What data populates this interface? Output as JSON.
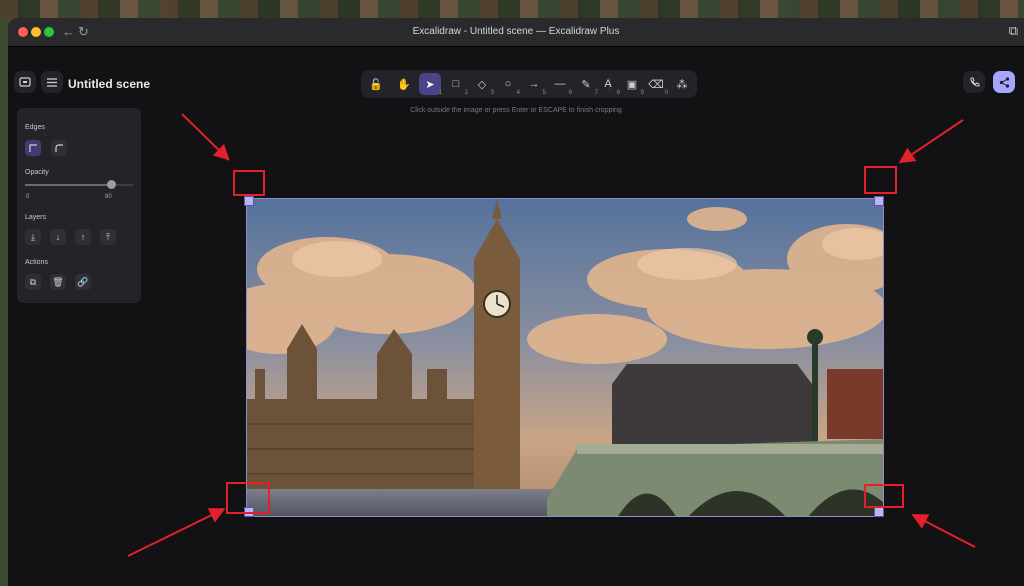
{
  "window": {
    "title": "Excalidraw - Untitled scene — Excalidraw Plus",
    "back_icon": "arrow-left-icon",
    "reload_icon": "reload-icon",
    "extension_icon": "puzzle-icon"
  },
  "header": {
    "scene_title": "Untitled scene",
    "library_icon": "library-icon",
    "menu_icon": "hamburger-icon",
    "call_icon": "phone-icon",
    "share_icon": "share-icon"
  },
  "toolbar": {
    "tools": [
      {
        "name": "lock",
        "glyph": "🔓",
        "key": ""
      },
      {
        "name": "hand",
        "glyph": "✋",
        "key": ""
      },
      {
        "name": "selection",
        "glyph": "➤",
        "key": "1"
      },
      {
        "name": "rectangle",
        "glyph": "□",
        "key": "2"
      },
      {
        "name": "diamond",
        "glyph": "◇",
        "key": "3"
      },
      {
        "name": "ellipse",
        "glyph": "○",
        "key": "4"
      },
      {
        "name": "arrow",
        "glyph": "→",
        "key": "5"
      },
      {
        "name": "line",
        "glyph": "—",
        "key": "6"
      },
      {
        "name": "draw",
        "glyph": "✎",
        "key": "7"
      },
      {
        "name": "text",
        "glyph": "A",
        "key": "8"
      },
      {
        "name": "image",
        "glyph": "▣",
        "key": "9"
      },
      {
        "name": "eraser",
        "glyph": "⌫",
        "key": "0"
      },
      {
        "name": "more",
        "glyph": "⁂",
        "key": ""
      }
    ],
    "active_tool": "selection"
  },
  "hint": "Click outside the image or press Enter or ESCAPE to finish cropping",
  "properties": {
    "edges_label": "Edges",
    "opacity_label": "Opacity",
    "opacity_min": "0",
    "opacity_value": "80",
    "opacity_fraction": 0.8,
    "layers_label": "Layers",
    "actions_label": "Actions",
    "layer_icons": [
      "send-to-back-icon",
      "send-backward-icon",
      "bring-forward-icon",
      "bring-to-front-icon"
    ],
    "action_icons": [
      "duplicate-icon",
      "delete-icon",
      "link-icon"
    ]
  },
  "colors": {
    "accent": "#4a4488",
    "share_button": "#a8a5ff",
    "selection_border": "#8e8ccb",
    "annotation_red": "#e3212b"
  }
}
